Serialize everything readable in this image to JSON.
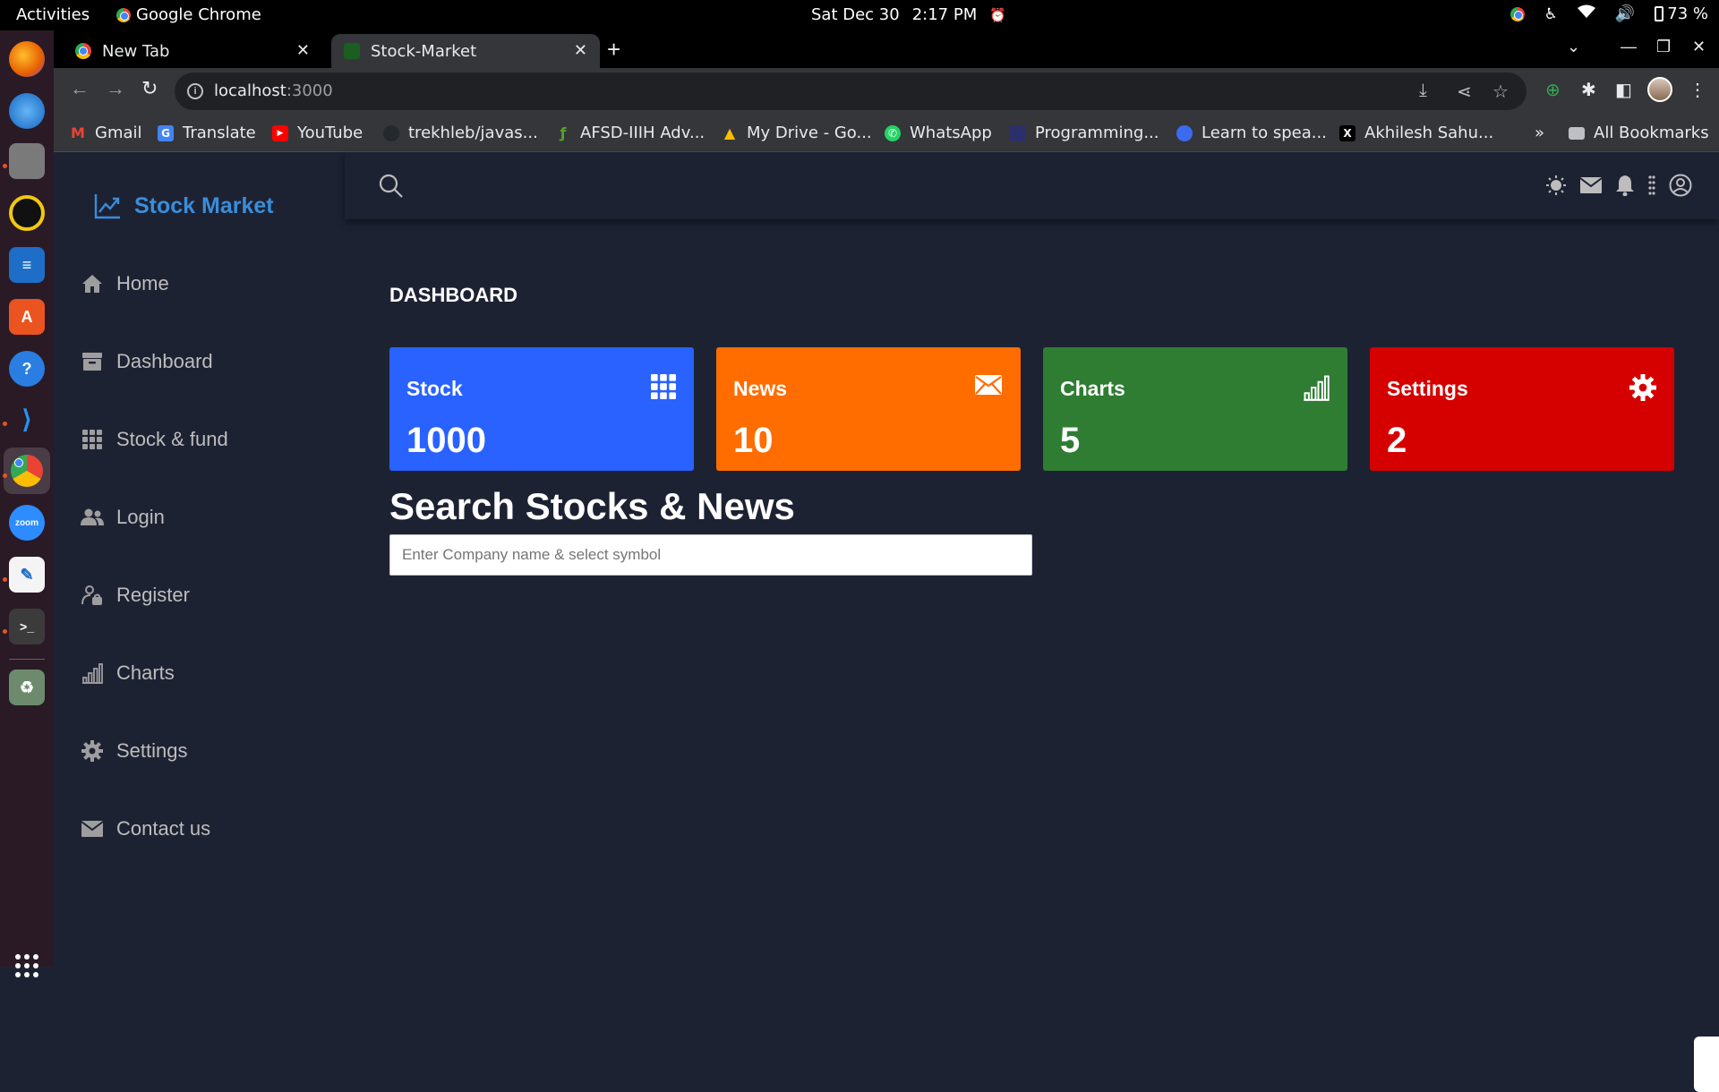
{
  "system": {
    "activities": "Activities",
    "app_name": "Google Chrome",
    "date": "Sat Dec 30",
    "time": "2:17 PM",
    "battery": "73 %"
  },
  "browser": {
    "tabs": [
      {
        "title": "New Tab",
        "active": false
      },
      {
        "title": "Stock-Market",
        "active": true
      }
    ],
    "url_host": "localhost",
    "url_port": ":3000",
    "bookmarks": [
      {
        "label": "Gmail",
        "icon": "gmail-icon",
        "color": "#ea4335"
      },
      {
        "label": "Translate",
        "icon": "translate-icon",
        "color": "#4285f4"
      },
      {
        "label": "YouTube",
        "icon": "youtube-icon",
        "color": "#ff0000"
      },
      {
        "label": "trekhleb/javas...",
        "icon": "github-icon",
        "color": "#24292e"
      },
      {
        "label": "AFSD-IIIH Adv...",
        "icon": "afsd-icon",
        "color": "#5aa02c"
      },
      {
        "label": "My Drive - Go...",
        "icon": "drive-icon",
        "color": "#fbbc05"
      },
      {
        "label": "WhatsApp",
        "icon": "whatsapp-icon",
        "color": "#25d366"
      },
      {
        "label": "Programming...",
        "icon": "programming-icon",
        "color": "#2d2f6b"
      },
      {
        "label": "Learn to spea...",
        "icon": "learn-icon",
        "color": "#3c6bf0"
      },
      {
        "label": "Akhilesh Sahu...",
        "icon": "x-icon",
        "color": "#000000"
      }
    ],
    "more_bookmarks": "»",
    "all_bookmarks": "All Bookmarks"
  },
  "app": {
    "brand": "Stock Market",
    "menu": [
      {
        "label": "Home",
        "icon": "home-icon"
      },
      {
        "label": "Dashboard",
        "icon": "archive-icon"
      },
      {
        "label": "Stock & fund",
        "icon": "grid-icon"
      },
      {
        "label": "Login",
        "icon": "users-icon"
      },
      {
        "label": "Register",
        "icon": "user-lock-icon"
      },
      {
        "label": "Charts",
        "icon": "bar-chart-icon"
      },
      {
        "label": "Settings",
        "icon": "gear-icon"
      },
      {
        "label": "Contact us",
        "icon": "envelope-icon"
      }
    ],
    "page_title": "DASHBOARD",
    "cards": [
      {
        "title": "Stock",
        "value": "1000",
        "icon": "grid-icon",
        "color": "#2962ff"
      },
      {
        "title": "News",
        "value": "10",
        "icon": "envelope-icon",
        "color": "#ff6d00"
      },
      {
        "title": "Charts",
        "value": "5",
        "icon": "bar-chart-icon",
        "color": "#2e7d32"
      },
      {
        "title": "Settings",
        "value": "2",
        "icon": "gear-icon",
        "color": "#d50000"
      }
    ],
    "search_heading": "Search Stocks & News",
    "search_placeholder": "Enter Company name & select symbol"
  }
}
